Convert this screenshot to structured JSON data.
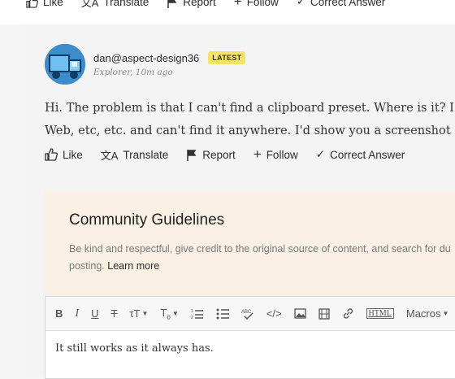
{
  "top_actions": {
    "like": "Like",
    "translate": "Translate",
    "report": "Report",
    "follow": "Follow",
    "correct_answer": "Correct Answer"
  },
  "post": {
    "author": "dan@aspect-design36",
    "badge": "LATEST",
    "meta": "Explorer, 10m ago",
    "body_line1": "Hi. The problem is that I can't find a clipboard preset. Where is it? I",
    "body_line2": "Web, etc, etc. and can't find it anywhere. I'd show you a screenshot -",
    "actions": {
      "like": "Like",
      "translate": "Translate",
      "report": "Report",
      "follow": "Follow",
      "correct_answer": "Correct Answer"
    }
  },
  "guidelines": {
    "title": "Community Guidelines",
    "text_line1": "Be kind and respectful, give credit to the original source of content, and search for du",
    "text_line2_prefix": "posting.",
    "learn_more": "Learn more"
  },
  "editor": {
    "toolbar": {
      "bold": "B",
      "italic": "I",
      "underline": "U",
      "strike": "T",
      "html": "HTML",
      "macros": "Macros"
    },
    "content": "It still works as it always has."
  },
  "colors": {
    "badge": "#f3e36a",
    "guidelines_bg": "#fbf0e4"
  }
}
